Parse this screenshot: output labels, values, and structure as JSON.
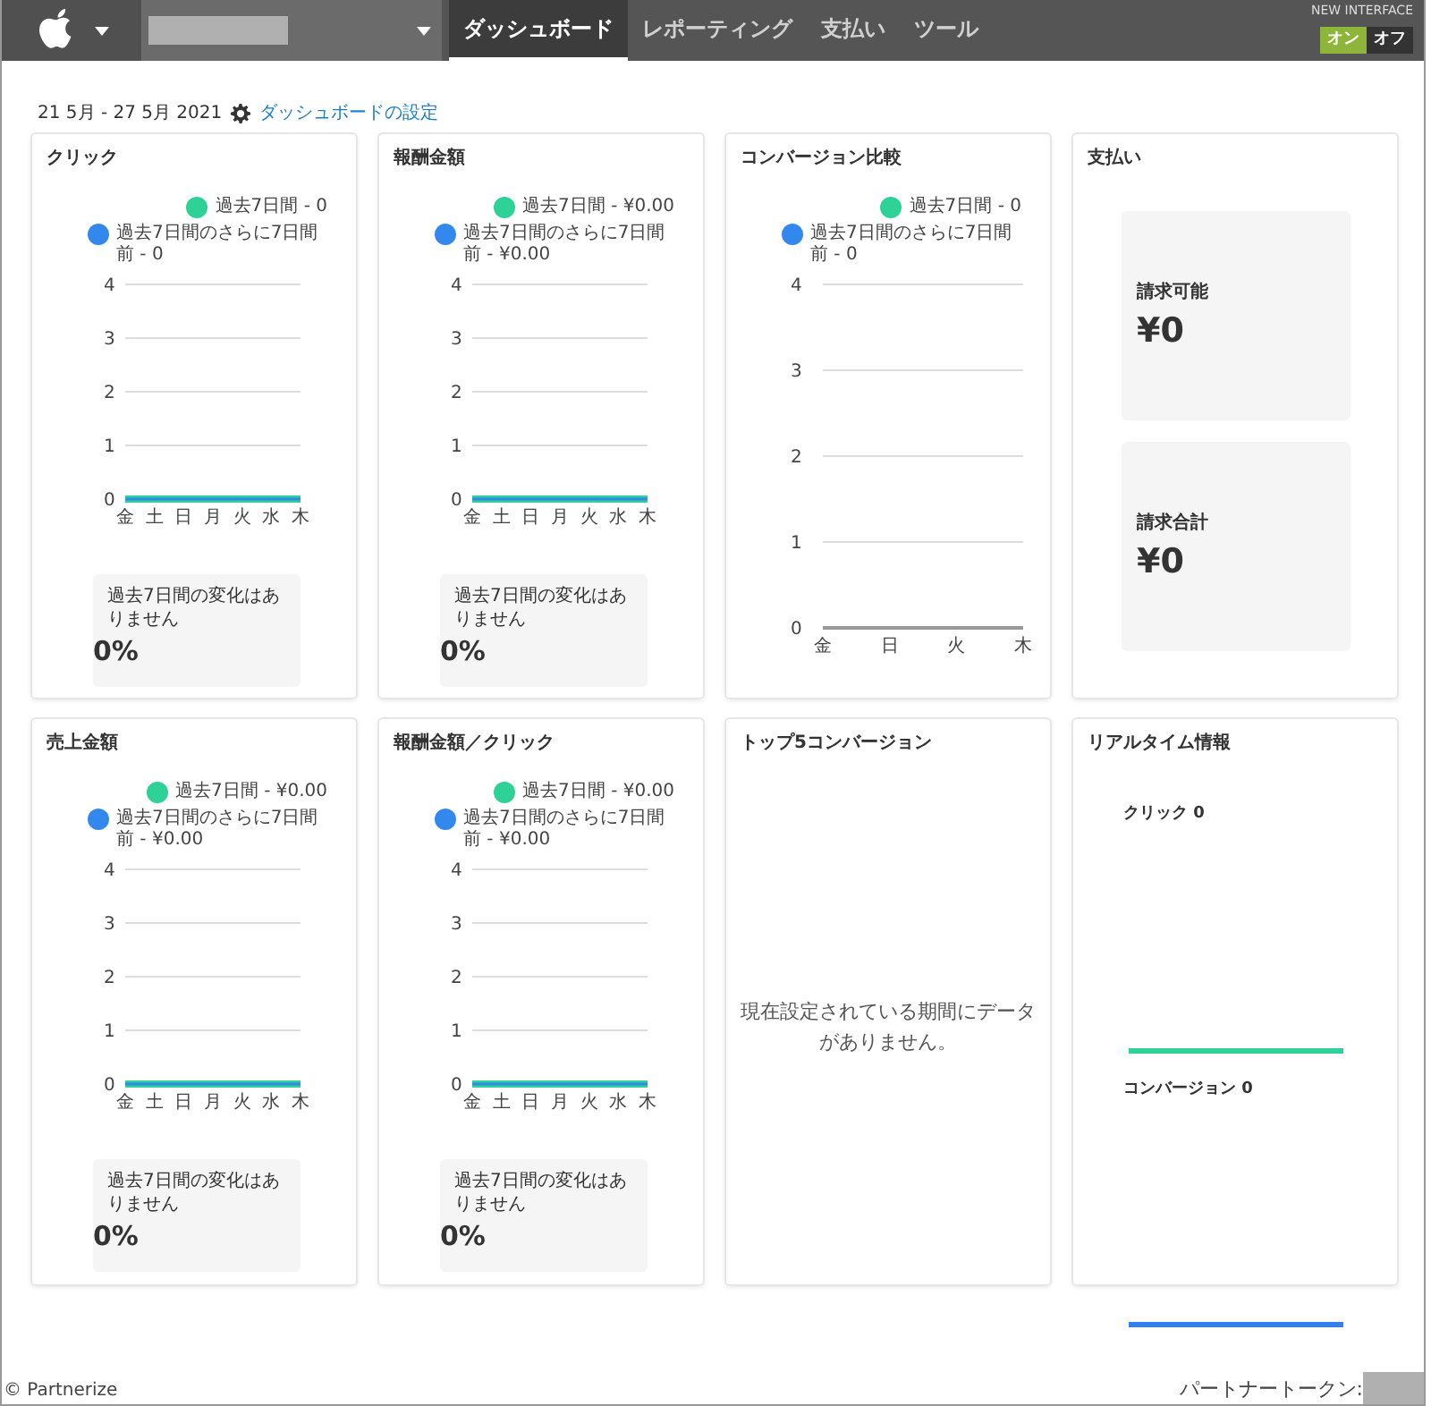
{
  "navbar": {
    "tabs": [
      {
        "label": "ダッシュボード",
        "selected": true
      },
      {
        "label": "レポーティング",
        "selected": false
      },
      {
        "label": "支払い",
        "selected": false
      },
      {
        "label": "ツール",
        "selected": false
      }
    ],
    "new_interface": {
      "label": "NEW INTERFACE",
      "options": [
        {
          "label": "オン",
          "selected": true
        },
        {
          "label": "オフ",
          "selected": false
        }
      ]
    }
  },
  "date_range": "21 5月 - 27 5月 2021",
  "settings_link": "ダッシュボードの設定",
  "cards": [
    {
      "kind": "chart",
      "title": "クリック",
      "chart_data": {
        "type": "line",
        "grid": true,
        "categories": [
          "金",
          "土",
          "日",
          "月",
          "火",
          "水",
          "木"
        ],
        "ylim": [
          0,
          4
        ],
        "yticks": [
          0,
          1,
          2,
          3,
          4
        ],
        "series": [
          {
            "name": "過去7日間 - 0",
            "color": "#2ed196",
            "values": [
              0,
              0,
              0,
              0,
              0,
              0,
              0
            ]
          },
          {
            "name": "過去7日間のさらに7日間前 - 0",
            "color": "#3388ee",
            "values": [
              0,
              0,
              0,
              0,
              0,
              0,
              0
            ]
          }
        ]
      },
      "summary": {
        "text": "過去7日間の変化はありません",
        "value": "0%"
      }
    },
    {
      "kind": "chart",
      "title": "報酬金額",
      "chart_data": {
        "type": "line",
        "grid": true,
        "categories": [
          "金",
          "土",
          "日",
          "月",
          "火",
          "水",
          "木"
        ],
        "ylim": [
          0,
          4
        ],
        "yticks": [
          0,
          1,
          2,
          3,
          4
        ],
        "series": [
          {
            "name": "過去7日間 - ¥0.00",
            "color": "#2ed196",
            "values": [
              0,
              0,
              0,
              0,
              0,
              0,
              0
            ]
          },
          {
            "name": "過去7日間のさらに7日間前 - ¥0.00",
            "color": "#3388ee",
            "values": [
              0,
              0,
              0,
              0,
              0,
              0,
              0
            ]
          }
        ]
      },
      "summary": {
        "text": "過去7日間の変化はありません",
        "value": "0%"
      }
    },
    {
      "kind": "chart",
      "title": "コンバージョン比較",
      "chart_data": {
        "type": "line",
        "grid": true,
        "categories": [
          "金",
          "日",
          "火",
          "木"
        ],
        "ylim": [
          0,
          4
        ],
        "yticks": [
          0,
          1,
          2,
          3,
          4
        ],
        "series": [
          {
            "name": "過去7日間 - 0",
            "color": "#2ed196",
            "values": [
              null,
              null,
              null,
              null
            ]
          },
          {
            "name": "過去7日間のさらに7日間前 - 0",
            "color": "#3388ee",
            "values": [
              null,
              null,
              null,
              null
            ]
          }
        ]
      }
    },
    {
      "kind": "payments",
      "title": "支払い",
      "items": [
        {
          "label": "請求可能",
          "amount": "¥0"
        },
        {
          "label": "請求合計",
          "amount": "¥0"
        }
      ]
    },
    {
      "kind": "chart",
      "title": "売上金額",
      "chart_data": {
        "type": "line",
        "grid": true,
        "categories": [
          "金",
          "土",
          "日",
          "月",
          "火",
          "水",
          "木"
        ],
        "ylim": [
          0,
          4
        ],
        "yticks": [
          0,
          1,
          2,
          3,
          4
        ],
        "series": [
          {
            "name": "過去7日間 - ¥0.00",
            "color": "#2ed196",
            "values": [
              0,
              0,
              0,
              0,
              0,
              0,
              0
            ]
          },
          {
            "name": "過去7日間のさらに7日間前 - ¥0.00",
            "color": "#3388ee",
            "values": [
              0,
              0,
              0,
              0,
              0,
              0,
              0
            ]
          }
        ]
      },
      "summary": {
        "text": "過去7日間の変化はありません",
        "value": "0%"
      }
    },
    {
      "kind": "chart",
      "title": "報酬金額／クリック",
      "chart_data": {
        "type": "line",
        "grid": true,
        "categories": [
          "金",
          "土",
          "日",
          "月",
          "火",
          "水",
          "木"
        ],
        "ylim": [
          0,
          4
        ],
        "yticks": [
          0,
          1,
          2,
          3,
          4
        ],
        "series": [
          {
            "name": "過去7日間 - ¥0.00",
            "color": "#2ed196",
            "values": [
              0,
              0,
              0,
              0,
              0,
              0,
              0
            ]
          },
          {
            "name": "過去7日間のさらに7日間前 - ¥0.00",
            "color": "#3388ee",
            "values": [
              0,
              0,
              0,
              0,
              0,
              0,
              0
            ]
          }
        ]
      },
      "summary": {
        "text": "過去7日間の変化はありません",
        "value": "0%"
      }
    },
    {
      "kind": "empty",
      "title": "トップ5コンバージョン",
      "message": "現在設定されている期間にデータがありません。"
    },
    {
      "kind": "realtime",
      "title": "リアルタイム情報",
      "items": [
        {
          "label": "クリック 0",
          "color": "#2ed196"
        },
        {
          "label": "コンバージョン 0",
          "color": "#3380e8"
        }
      ]
    }
  ],
  "footer": {
    "copyright": "© Partnerize",
    "token_label": "パートナートークン:"
  }
}
